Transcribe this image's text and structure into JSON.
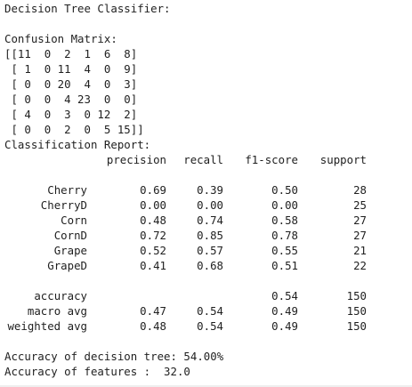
{
  "output": {
    "title": "Decision Tree Classifier:",
    "cm_label": "Confusion Matrix:",
    "cm_rows": [
      "[[11  0  2  1  6  8]",
      " [ 1  0 11  4  0  9]",
      " [ 0  0 20  4  0  3]",
      " [ 0  0  4 23  0  0]",
      " [ 4  0  3  0 12  2]",
      " [ 0  0  2  0  5 15]]"
    ],
    "report_label": "Classification Report:",
    "report_header": {
      "precision": "precision",
      "recall": "recall",
      "f1": "f1-score",
      "support": "support"
    },
    "report_classes": [
      {
        "label": "Cherry",
        "precision": "0.69",
        "recall": "0.39",
        "f1": "0.50",
        "support": "28"
      },
      {
        "label": "CherryD",
        "precision": "0.00",
        "recall": "0.00",
        "f1": "0.00",
        "support": "25"
      },
      {
        "label": "Corn",
        "precision": "0.48",
        "recall": "0.74",
        "f1": "0.58",
        "support": "27"
      },
      {
        "label": "CornD",
        "precision": "0.72",
        "recall": "0.85",
        "f1": "0.78",
        "support": "27"
      },
      {
        "label": "Grape",
        "precision": "0.52",
        "recall": "0.57",
        "f1": "0.55",
        "support": "21"
      },
      {
        "label": "GrapeD",
        "precision": "0.41",
        "recall": "0.68",
        "f1": "0.51",
        "support": "22"
      }
    ],
    "report_summary": [
      {
        "label": "accuracy",
        "precision": "",
        "recall": "",
        "f1": "0.54",
        "support": "150"
      },
      {
        "label": "macro avg",
        "precision": "0.47",
        "recall": "0.54",
        "f1": "0.49",
        "support": "150"
      },
      {
        "label": "weighted avg",
        "precision": "0.48",
        "recall": "0.54",
        "f1": "0.49",
        "support": "150"
      }
    ],
    "accuracy_line": "Accuracy of decision tree: 54.00%",
    "features_line": "Accuracy of features :  32.0"
  }
}
